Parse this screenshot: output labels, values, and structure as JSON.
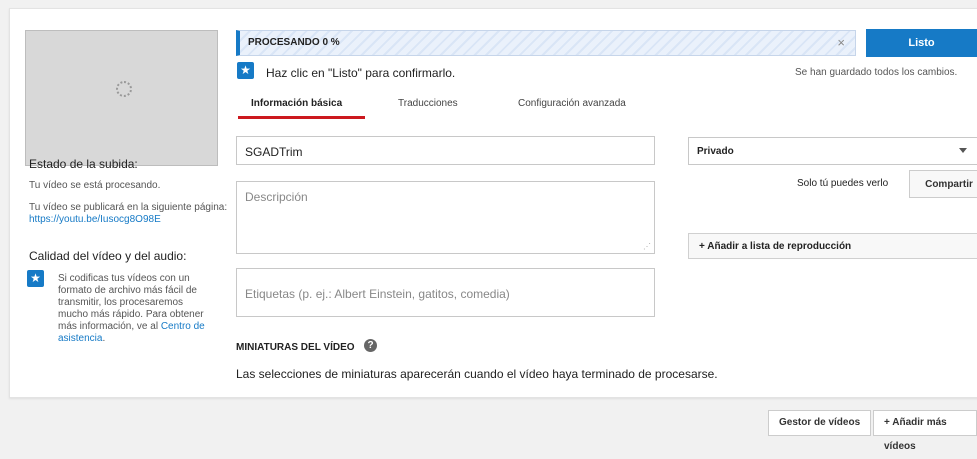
{
  "progress": {
    "label": "PROCESANDO 0 %",
    "close_icon": "×"
  },
  "buttons": {
    "listo": "Listo",
    "compartir": "Compartir",
    "playlist": "+ Añadir a lista de reproducción"
  },
  "confirm_text": "Haz clic en \"Listo\" para confirmarlo.",
  "saved_text": "Se han guardado todos los cambios.",
  "tabs": [
    {
      "label": "Información básica"
    },
    {
      "label": "Traducciones"
    },
    {
      "label": "Configuración avanzada"
    }
  ],
  "left": {
    "upload_status_title": "Estado de la subida:",
    "upload_status_text": "Tu vídeo se está procesando.",
    "publish_prefix": "Tu vídeo se publicará en la siguiente página: ",
    "publish_link": "https://youtu.be/Iusocg8O98E",
    "quality_title": "Calidad del vídeo y del audio:",
    "quality_text": "Si codificas tus vídeos con un formato de archivo más fácil de transmitir, los procesaremos mucho más rápido. Para obtener más información, ve al ",
    "quality_link": "Centro de asistencia",
    "quality_suffix": "."
  },
  "form": {
    "title_value": "SGADTrim",
    "description_placeholder": "Descripción",
    "tags_placeholder": "Etiquetas (p. ej.: Albert Einstein, gatitos, comedia)"
  },
  "privacy": {
    "selected": "Privado",
    "note": "Solo tú puedes verlo"
  },
  "thumbnails": {
    "title": "MINIATURAS DEL VÍDEO",
    "help_icon": "?",
    "message": "Las selecciones de miniaturas aparecerán cuando el vídeo haya terminado de procesarse."
  },
  "footer": {
    "gestor": "Gestor de vídeos",
    "add_more": "+ Añadir más vídeos"
  },
  "icons": {
    "star": "★"
  },
  "colors": {
    "accent": "#167ac6",
    "tab_underline": "#cc181e"
  }
}
